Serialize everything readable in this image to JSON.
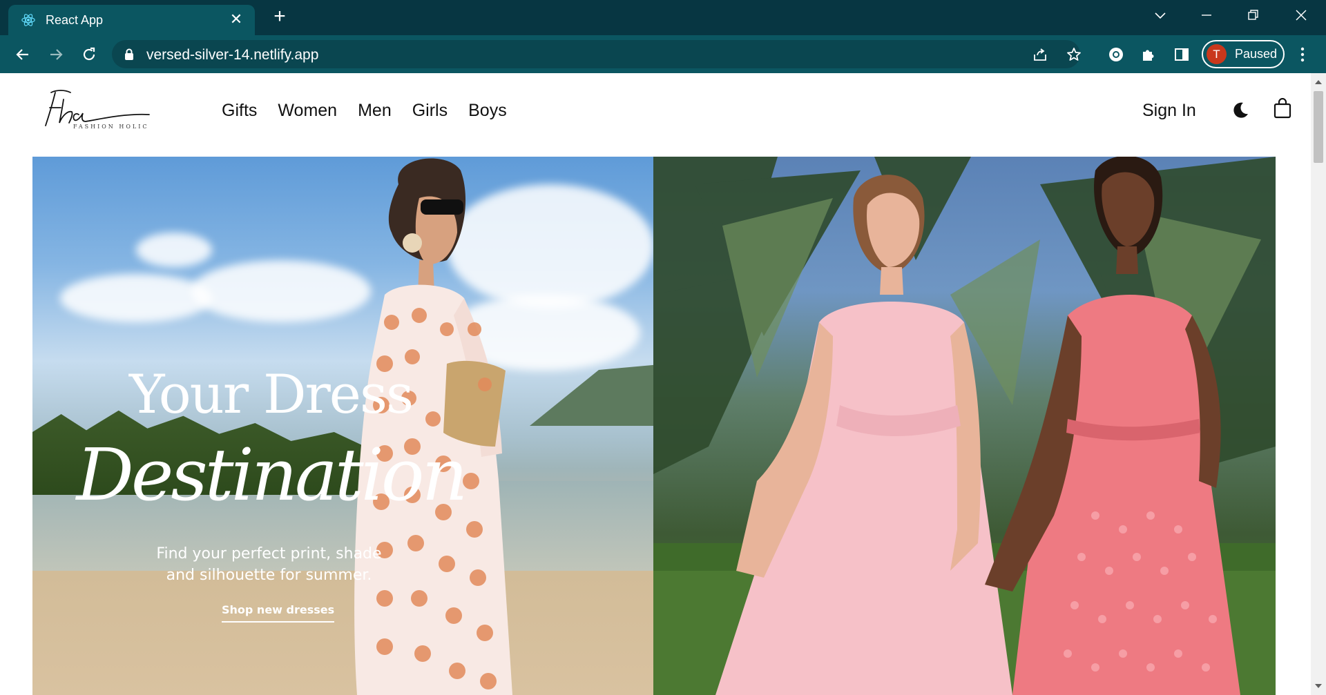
{
  "browser": {
    "tab_title": "React App",
    "tab_close": "✕",
    "new_tab": "+",
    "url": "versed-silver-14.netlify.app",
    "profile_initial": "T",
    "profile_status": "Paused"
  },
  "site": {
    "nav": [
      "Gifts",
      "Women",
      "Men",
      "Girls",
      "Boys"
    ],
    "sign_in": "Sign In"
  },
  "hero": {
    "title_line1": "Your Dress",
    "title_line2": "Destination",
    "subtitle_line1": "Find your perfect print, shade",
    "subtitle_line2": "and silhouette for summer.",
    "cta": "Shop new dresses"
  },
  "colors": {
    "chrome_tabbar": "#073642",
    "chrome_toolbar": "#0b5661",
    "avatar": "#c9381c"
  }
}
